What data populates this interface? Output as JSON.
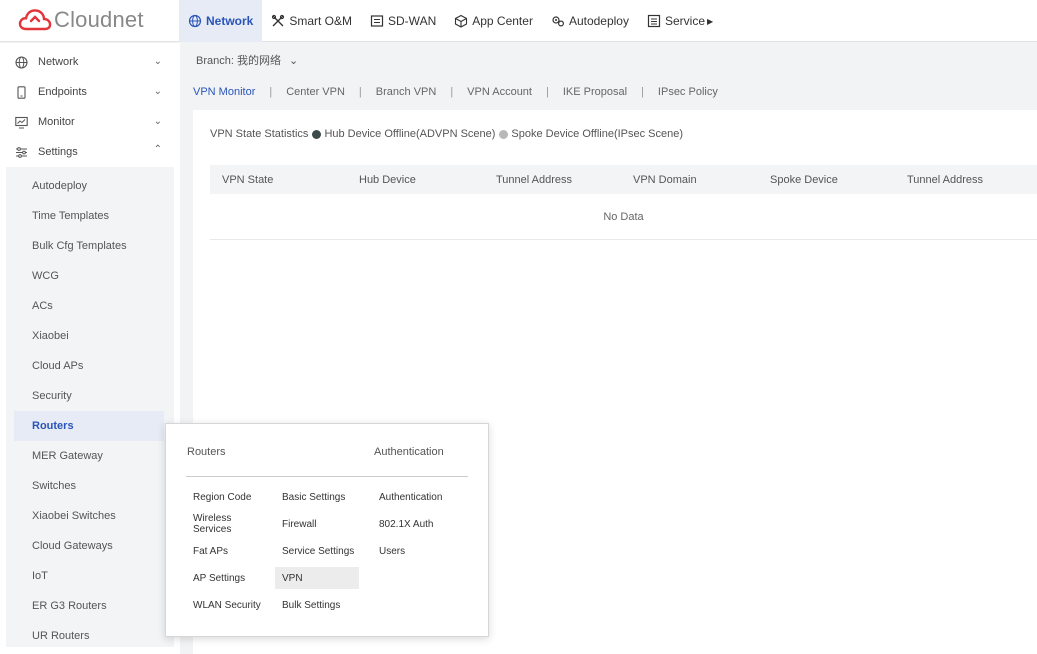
{
  "brand": {
    "name": "Cloudnet",
    "logo_color": "#e2353a"
  },
  "nav": [
    {
      "label": "Network",
      "icon": "globe-icon",
      "active": true
    },
    {
      "label": "Smart O&M",
      "icon": "tools-icon"
    },
    {
      "label": "SD-WAN",
      "icon": "sdwan-icon"
    },
    {
      "label": "App Center",
      "icon": "box-icon"
    },
    {
      "label": "Autodeploy",
      "icon": "gears-icon"
    },
    {
      "label": "Service",
      "icon": "list-icon"
    }
  ],
  "sidebar": {
    "groups": [
      {
        "label": "Network",
        "icon": "globe-icon",
        "chevron": "down"
      },
      {
        "label": "Endpoints",
        "icon": "phone-icon",
        "chevron": "down"
      },
      {
        "label": "Monitor",
        "icon": "monitor-icon",
        "chevron": "down"
      },
      {
        "label": "Settings",
        "icon": "sliders-icon",
        "chevron": "up"
      }
    ],
    "items": [
      {
        "label": "Autodeploy"
      },
      {
        "label": "Time Templates"
      },
      {
        "label": "Bulk Cfg Templates"
      },
      {
        "label": "WCG"
      },
      {
        "label": "ACs"
      },
      {
        "label": "Xiaobei"
      },
      {
        "label": "Cloud APs"
      },
      {
        "label": "Security"
      },
      {
        "label": "Routers",
        "active": true
      },
      {
        "label": "MER Gateway"
      },
      {
        "label": "Switches"
      },
      {
        "label": "Xiaobei Switches"
      },
      {
        "label": "Cloud Gateways"
      },
      {
        "label": "IoT"
      },
      {
        "label": "ER G3 Routers"
      },
      {
        "label": "UR Routers"
      }
    ]
  },
  "branch": {
    "label": "Branch: 我的网络",
    "dropdown": "⌄"
  },
  "tabs": [
    {
      "label": "VPN Monitor",
      "active": true
    },
    {
      "label": "Center VPN"
    },
    {
      "label": "Branch VPN"
    },
    {
      "label": "VPN Account"
    },
    {
      "label": "IKE Proposal"
    },
    {
      "label": "IPsec Policy"
    }
  ],
  "tab_separator": "|",
  "stats": {
    "label": "VPN State Statistics",
    "legend": [
      {
        "label": "Hub Device Offline(ADVPN Scene)",
        "color": "#3d4a4a"
      },
      {
        "label": "Spoke Device Offline(IPsec Scene)",
        "color": "#b8b8b8"
      }
    ]
  },
  "table": {
    "columns": [
      "VPN State",
      "Hub Device",
      "Tunnel Address",
      "VPN Domain",
      "Spoke Device",
      "Tunnel Address"
    ],
    "empty_text": "No Data"
  },
  "flyout": {
    "headers": [
      "Routers",
      "Authentication"
    ],
    "col1": [
      "Region Code",
      "Wireless Services",
      "Fat APs",
      "AP Settings",
      "WLAN Security"
    ],
    "col2": [
      "Basic Settings",
      "Firewall",
      "Service Settings",
      "VPN",
      "Bulk Settings"
    ],
    "col3": [
      "Authentication",
      "802.1X Auth",
      "Users"
    ],
    "selected": "VPN"
  },
  "colors": {
    "accent": "#2a55b8",
    "active_bg": "#e6ebf6"
  }
}
